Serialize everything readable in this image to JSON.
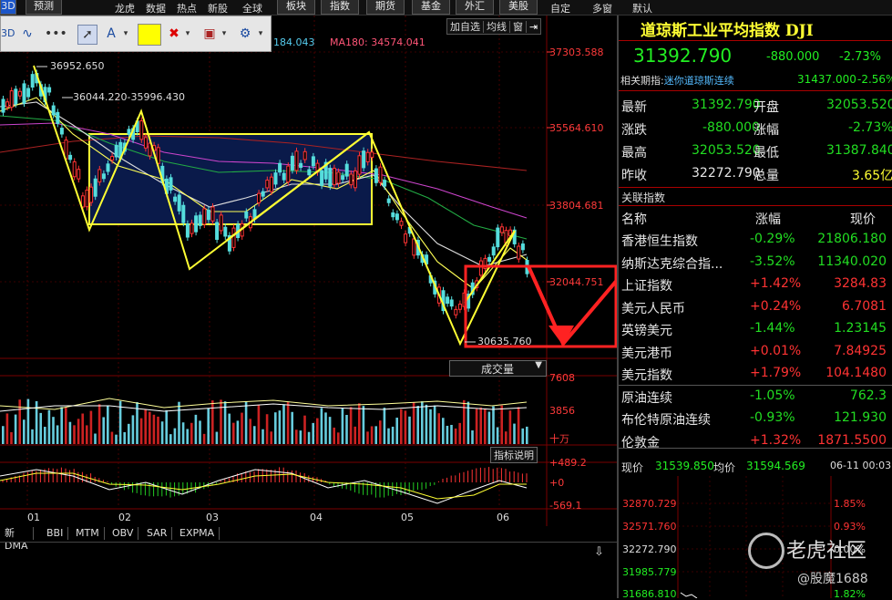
{
  "top_menu": {
    "items": [
      "3D",
      "预测",
      "龙虎",
      "数据",
      "热点",
      "新股",
      "全球",
      "板块",
      "指数",
      "期货",
      "基金",
      "外汇",
      "美股",
      "自定",
      "多窗",
      "默认"
    ]
  },
  "toolbar": {
    "text_tool": "A",
    "marker": "▾"
  },
  "chart": {
    "ma_info_left": "184.043",
    "ma180": "MA180: 34574.041",
    "high_label": "36952.650",
    "range_label": "36044.220-35996.430",
    "low_label": "30635.760",
    "right_btns": [
      "加自选",
      "均线",
      "窗"
    ],
    "y_ticks": [
      "37303.588",
      "35564.610",
      "33804.681",
      "32044.751"
    ],
    "volume_select": "成交量",
    "vol_ticks": [
      "7608",
      "3856",
      "十万"
    ],
    "macd_btn": "指标说明",
    "macd_ticks": [
      "+489.2",
      "+0",
      "-569.1"
    ],
    "months": [
      "01",
      "02",
      "03",
      "04",
      "05",
      "06"
    ],
    "bottom_tabs": [
      "新DMA",
      "BBI",
      "MTM",
      "OBV",
      "SAR",
      "EXPMA"
    ],
    "colors": {
      "up": "#ff3333",
      "down": "#55dddd",
      "zone": "#0a1a4a",
      "yellow": "#ffff33"
    }
  },
  "panel": {
    "title": "道琼斯工业平均指数 DJI",
    "price": "31392.790",
    "change": "-880.000",
    "pct": "-2.73%",
    "related_label": "相关期指:",
    "related_name": "迷你道琼斯连续",
    "related_price": "31437.000",
    "related_pct": "-2.56%",
    "stats": [
      {
        "k1": "最新",
        "v1": "31392.790",
        "k2": "开盘",
        "v2": "32053.520"
      },
      {
        "k1": "涨跌",
        "v1": "-880.000",
        "k2": "涨幅",
        "v2": "-2.73%"
      },
      {
        "k1": "最高",
        "v1": "32053.520",
        "k2": "最低",
        "v2": "31387.840"
      },
      {
        "k1": "昨收",
        "v1": "32272.790",
        "k2": "总量",
        "v2": "3.65亿"
      }
    ],
    "related_header": "关联指数",
    "cols": [
      "名称",
      "涨幅",
      "现价"
    ],
    "rows": [
      {
        "name": "香港恒生指数",
        "pct": "-0.29%",
        "price": "21806.180"
      },
      {
        "name": "纳斯达克综合指...",
        "pct": "-3.52%",
        "price": "11340.020"
      },
      {
        "name": "上证指数",
        "pct": "+1.42%",
        "price": "3284.83"
      },
      {
        "name": "美元人民币",
        "pct": "+0.24%",
        "price": "6.7081"
      },
      {
        "name": "英镑美元",
        "pct": "-1.44%",
        "price": "1.23145"
      },
      {
        "name": "美元港币",
        "pct": "+0.01%",
        "price": "7.84925"
      },
      {
        "name": "美元指数",
        "pct": "+1.79%",
        "price": "104.1480"
      },
      {
        "name": "原油连续",
        "pct": "-1.05%",
        "price": "762.3"
      },
      {
        "name": "布伦特原油连续",
        "pct": "-0.93%",
        "price": "121.930"
      },
      {
        "name": "伦敦金",
        "pct": "+1.32%",
        "price": "1871.5500"
      }
    ],
    "mini_now_label": "现价",
    "mini_now": "31539.850",
    "mini_avg_label": "均价",
    "mini_avg": "31594.569",
    "mini_date": "06-11 00:03",
    "mini_ticks": [
      "32870.729",
      "32571.760",
      "32272.790",
      "31985.779",
      "31686.810"
    ],
    "mini_pcts": [
      "1.85%",
      "0.93%",
      "0.00%",
      "",
      "1.82%"
    ],
    "watermark": "老虎社区",
    "author": "@股魔1688"
  }
}
